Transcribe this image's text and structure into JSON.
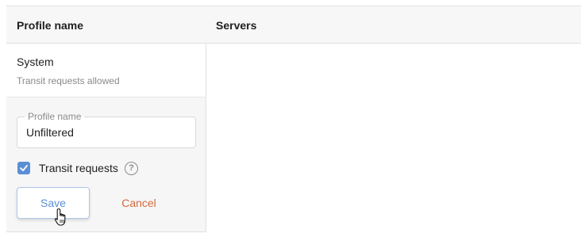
{
  "table": {
    "headers": {
      "profile_name": "Profile name",
      "servers": "Servers"
    },
    "rows": [
      {
        "name": "System",
        "description": "Transit requests allowed"
      }
    ]
  },
  "edit_form": {
    "profile_name_label": "Profile name",
    "profile_name_value": "Unfiltered",
    "transit_requests_label": "Transit requests",
    "transit_requests_checked": true,
    "help_icon_glyph": "?",
    "save_label": "Save",
    "cancel_label": "Cancel"
  },
  "colors": {
    "accent": "#5a8fd6",
    "cancel": "#d4693f",
    "header_bg": "#f7f7f7",
    "panel_bg": "#f6f6f6"
  },
  "icons": {
    "checkbox": "check-icon",
    "help": "question-circle-icon",
    "cursor": "hand-pointer-icon"
  }
}
